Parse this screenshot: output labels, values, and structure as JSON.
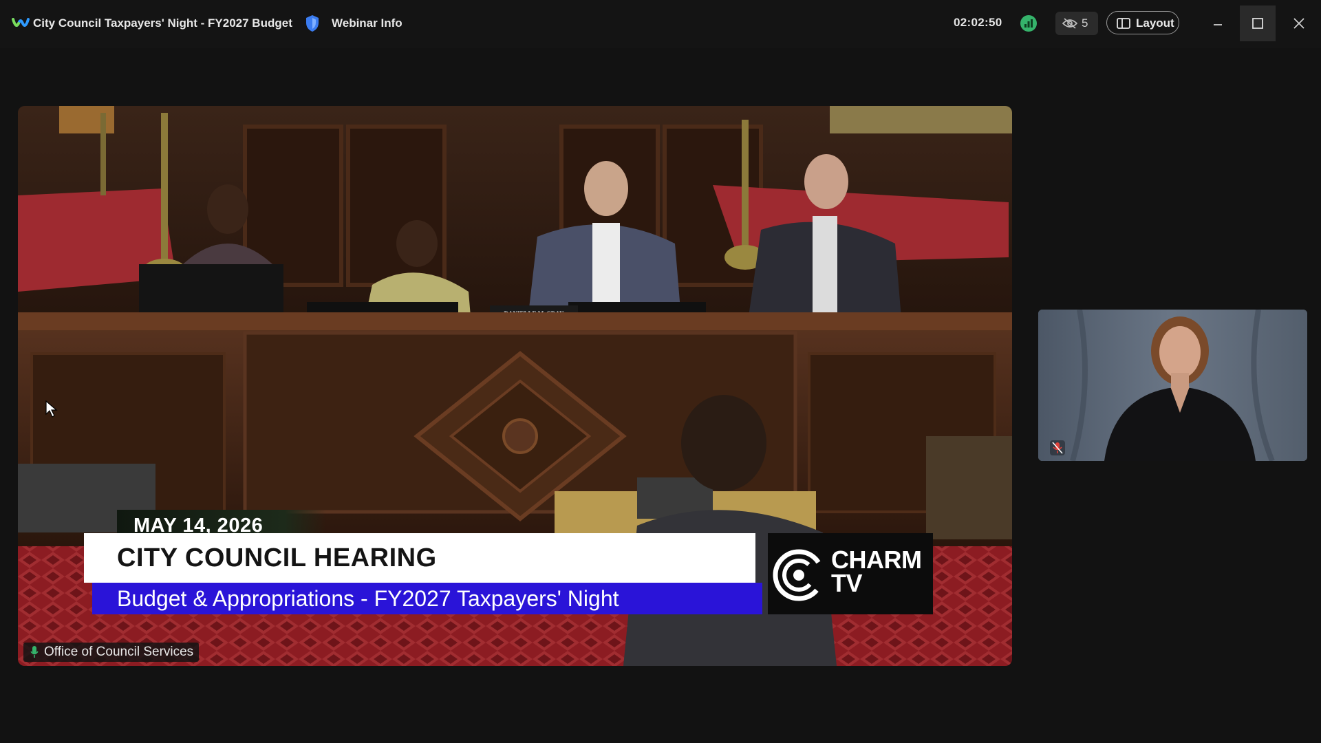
{
  "titlebar": {
    "app_logo": "webex-logo-icon",
    "title": "City Council Taxpayers' Night - FY2027 Budget",
    "webinar_info_icon": "shield-icon",
    "webinar_info_label": "Webinar Info",
    "elapsed_time": "02:02:50",
    "network_icon": "network-status-icon",
    "viewer_icon": "eye-slash-icon",
    "viewer_count": "5",
    "layout_icon": "layout-icon",
    "layout_label": "Layout",
    "window_controls": [
      "minimize-icon",
      "maximize-icon",
      "close-icon"
    ]
  },
  "main_video": {
    "nameplate": "DANIELLE McCRAY",
    "lower_third": {
      "date": "MAY 14, 2026",
      "headline": "CITY COUNCIL HEARING",
      "subheadline": "Budget & Appropriations - FY2027 Taxpayers' Night"
    },
    "channel_logo_line1": "CHARM",
    "channel_logo_line2": "TV",
    "source_icon": "microphone-icon",
    "source_label": "Office of Council Services"
  },
  "side_video": {
    "mic_status_icon": "muted-microphone-icon"
  },
  "colors": {
    "app_background": "#121212",
    "lower_third_blue": "#2a14d8",
    "network_green": "#35b36b",
    "carpet_red": "#8c1c22"
  }
}
